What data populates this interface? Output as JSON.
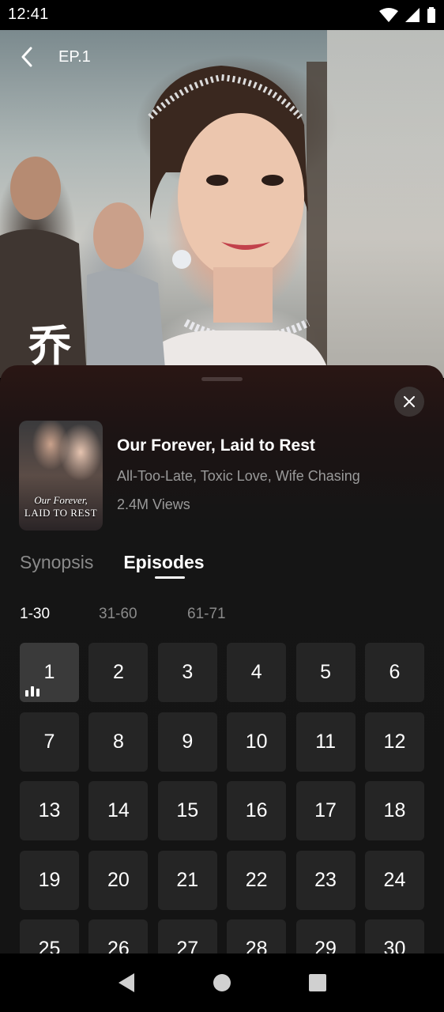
{
  "status_bar": {
    "time": "12:41"
  },
  "player": {
    "episode_label": "EP.1",
    "subtitle_char": "乔"
  },
  "show": {
    "poster_title_line1": "Our Forever,",
    "poster_title_line2": "LAID TO REST",
    "title": "Our Forever, Laid to Rest",
    "tags": "All-Too-Late, Toxic Love, Wife Chasing",
    "views": "2.4M Views"
  },
  "tabs": [
    {
      "label": "Synopsis",
      "active": false
    },
    {
      "label": "Episodes",
      "active": true
    }
  ],
  "ranges": [
    {
      "label": "1-30",
      "active": true
    },
    {
      "label": "31-60",
      "active": false
    },
    {
      "label": "61-71",
      "active": false
    }
  ],
  "episodes": [
    "1",
    "2",
    "3",
    "4",
    "5",
    "6",
    "7",
    "8",
    "9",
    "10",
    "11",
    "12",
    "13",
    "14",
    "15",
    "16",
    "17",
    "18",
    "19",
    "20",
    "21",
    "22",
    "23",
    "24",
    "25",
    "26",
    "27",
    "28",
    "29",
    "30"
  ],
  "current_episode": "1",
  "colors": {
    "sheet_bg": "#141414",
    "tile_bg": "#252525",
    "tile_current_bg": "#3a3a3a",
    "muted_text": "#8a8a8a"
  }
}
